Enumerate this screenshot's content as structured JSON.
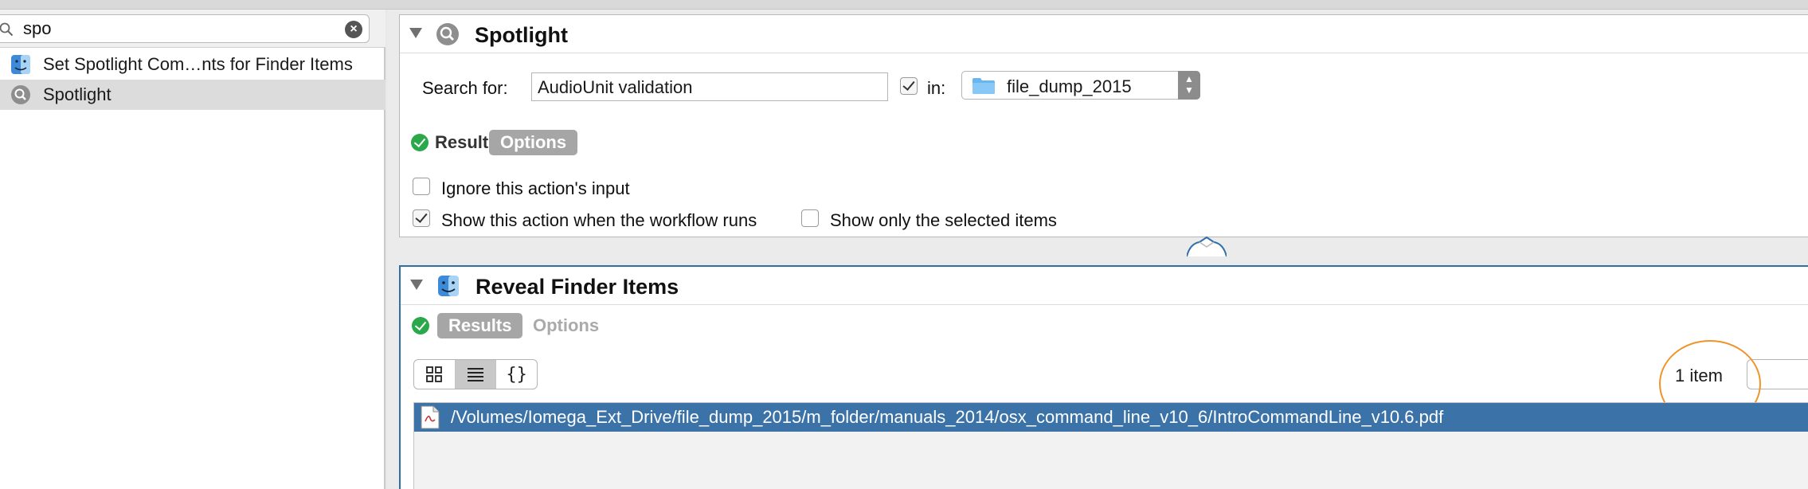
{
  "search": {
    "value": "spo"
  },
  "library": {
    "items": [
      {
        "label": "Set Spotlight Com…nts for Finder Items",
        "icon": "finder-icon",
        "selected": false
      },
      {
        "label": "Spotlight",
        "icon": "spotlight-icon",
        "selected": true
      }
    ]
  },
  "action1": {
    "title": "Spotlight",
    "icon": "spotlight-icon",
    "search_for_label": "Search for:",
    "search_for_value": "AudioUnit validation",
    "in_checked": true,
    "in_label": "in:",
    "location_value": "file_dump_2015",
    "tabs": {
      "results": "Results",
      "options": "Options",
      "active": "options"
    },
    "options": {
      "ignore_input": {
        "label": "Ignore this action's input",
        "checked": false
      },
      "show_when_runs": {
        "label": "Show this action when the workflow runs",
        "checked": true
      },
      "show_only_selected": {
        "label": "Show only the selected items",
        "checked": false
      }
    }
  },
  "action2": {
    "title": "Reveal Finder Items",
    "icon": "finder-icon",
    "tabs": {
      "results": "Results",
      "options": "Options",
      "active": "results"
    },
    "view_modes": [
      "icon-view",
      "list-view",
      "json-view"
    ],
    "view_mode_selected": "list-view",
    "json_view_glyph": "{}",
    "item_count": "1 item",
    "results": [
      "/Volumes/Iomega_Ext_Drive/file_dump_2015/m_folder/manuals_2014/osx_command_line_v10_6/IntroCommandLine_v10.6.pdf"
    ]
  },
  "colors": {
    "selection": "#3b73a9",
    "accent_card_border": "#2f6fa8",
    "annotation": "#f0932b",
    "ok": "#2aa84a"
  }
}
